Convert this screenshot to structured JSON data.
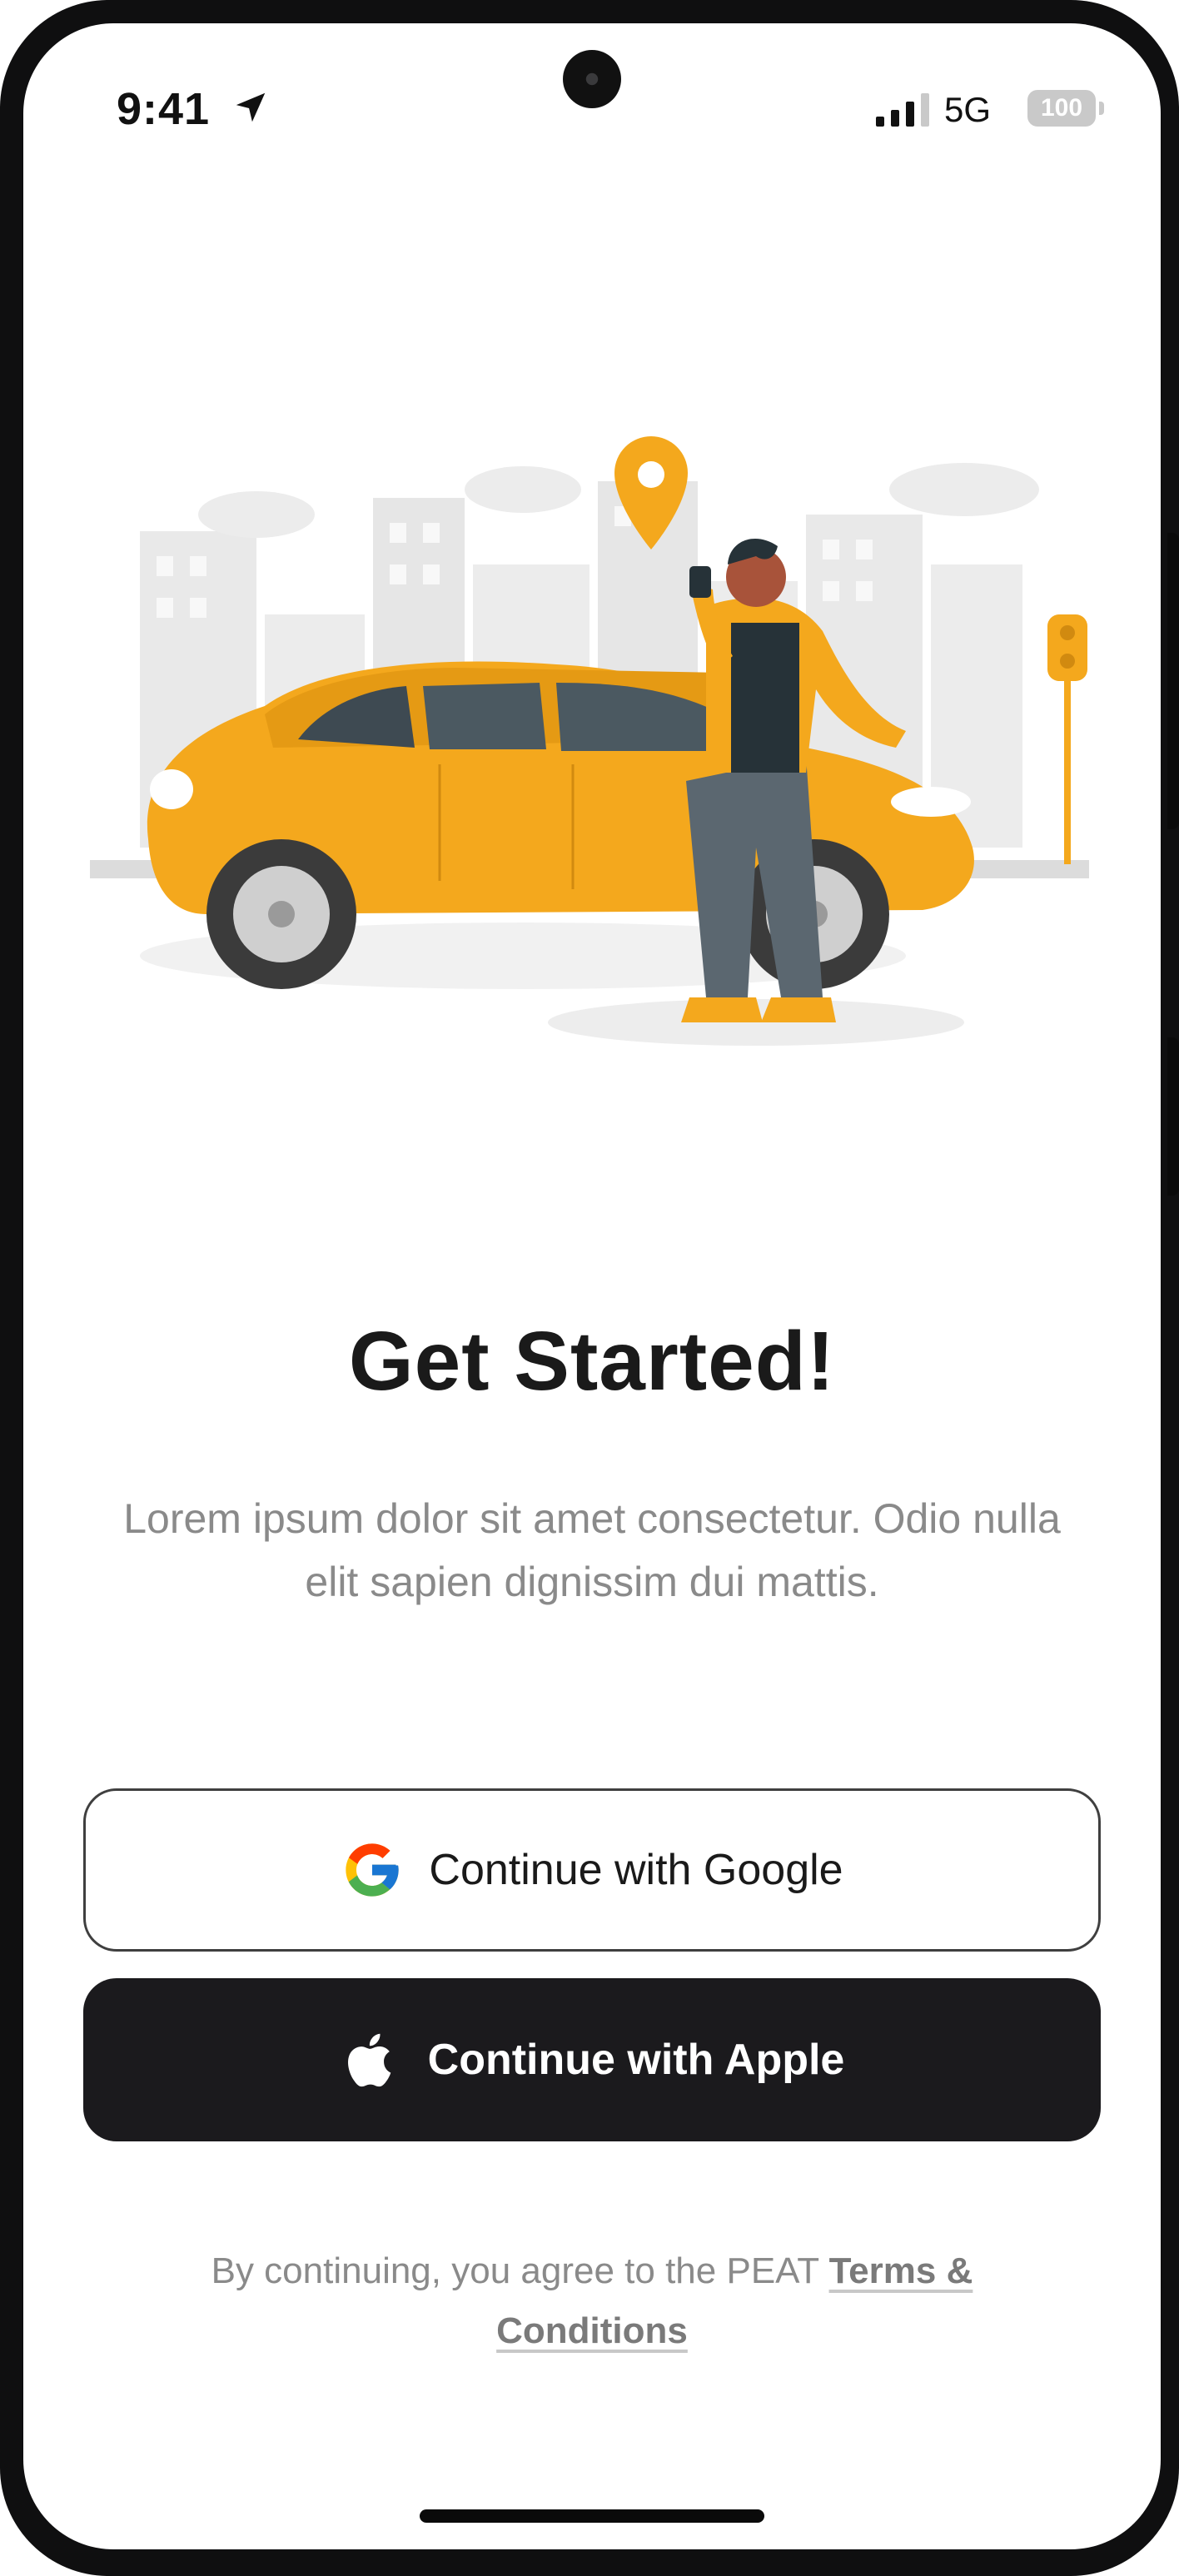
{
  "status_bar": {
    "time": "9:41",
    "location_icon": "location-arrow-icon",
    "signal_icon": "cellular-signal-icon",
    "network": "5G",
    "battery": "100"
  },
  "illustration": {
    "subject": "taxi-car-illustration",
    "accent_color": "#F4A81D"
  },
  "onboarding": {
    "title": "Get Started!",
    "subtitle": "Lorem ipsum dolor sit amet consectetur. Odio nulla elit sapien dignissim dui mattis."
  },
  "buttons": {
    "google": {
      "label": "Continue with Google",
      "icon": "google-g-icon"
    },
    "apple": {
      "label": "Continue with Apple",
      "icon": "apple-logo-icon"
    }
  },
  "legal": {
    "prefix": "By continuing, you agree to the PEAT",
    "link": "Terms & Conditions"
  },
  "colors": {
    "brand_yellow": "#F4A81D",
    "primary_dark": "#1B1A1D",
    "text_muted": "#8A8A8A"
  }
}
